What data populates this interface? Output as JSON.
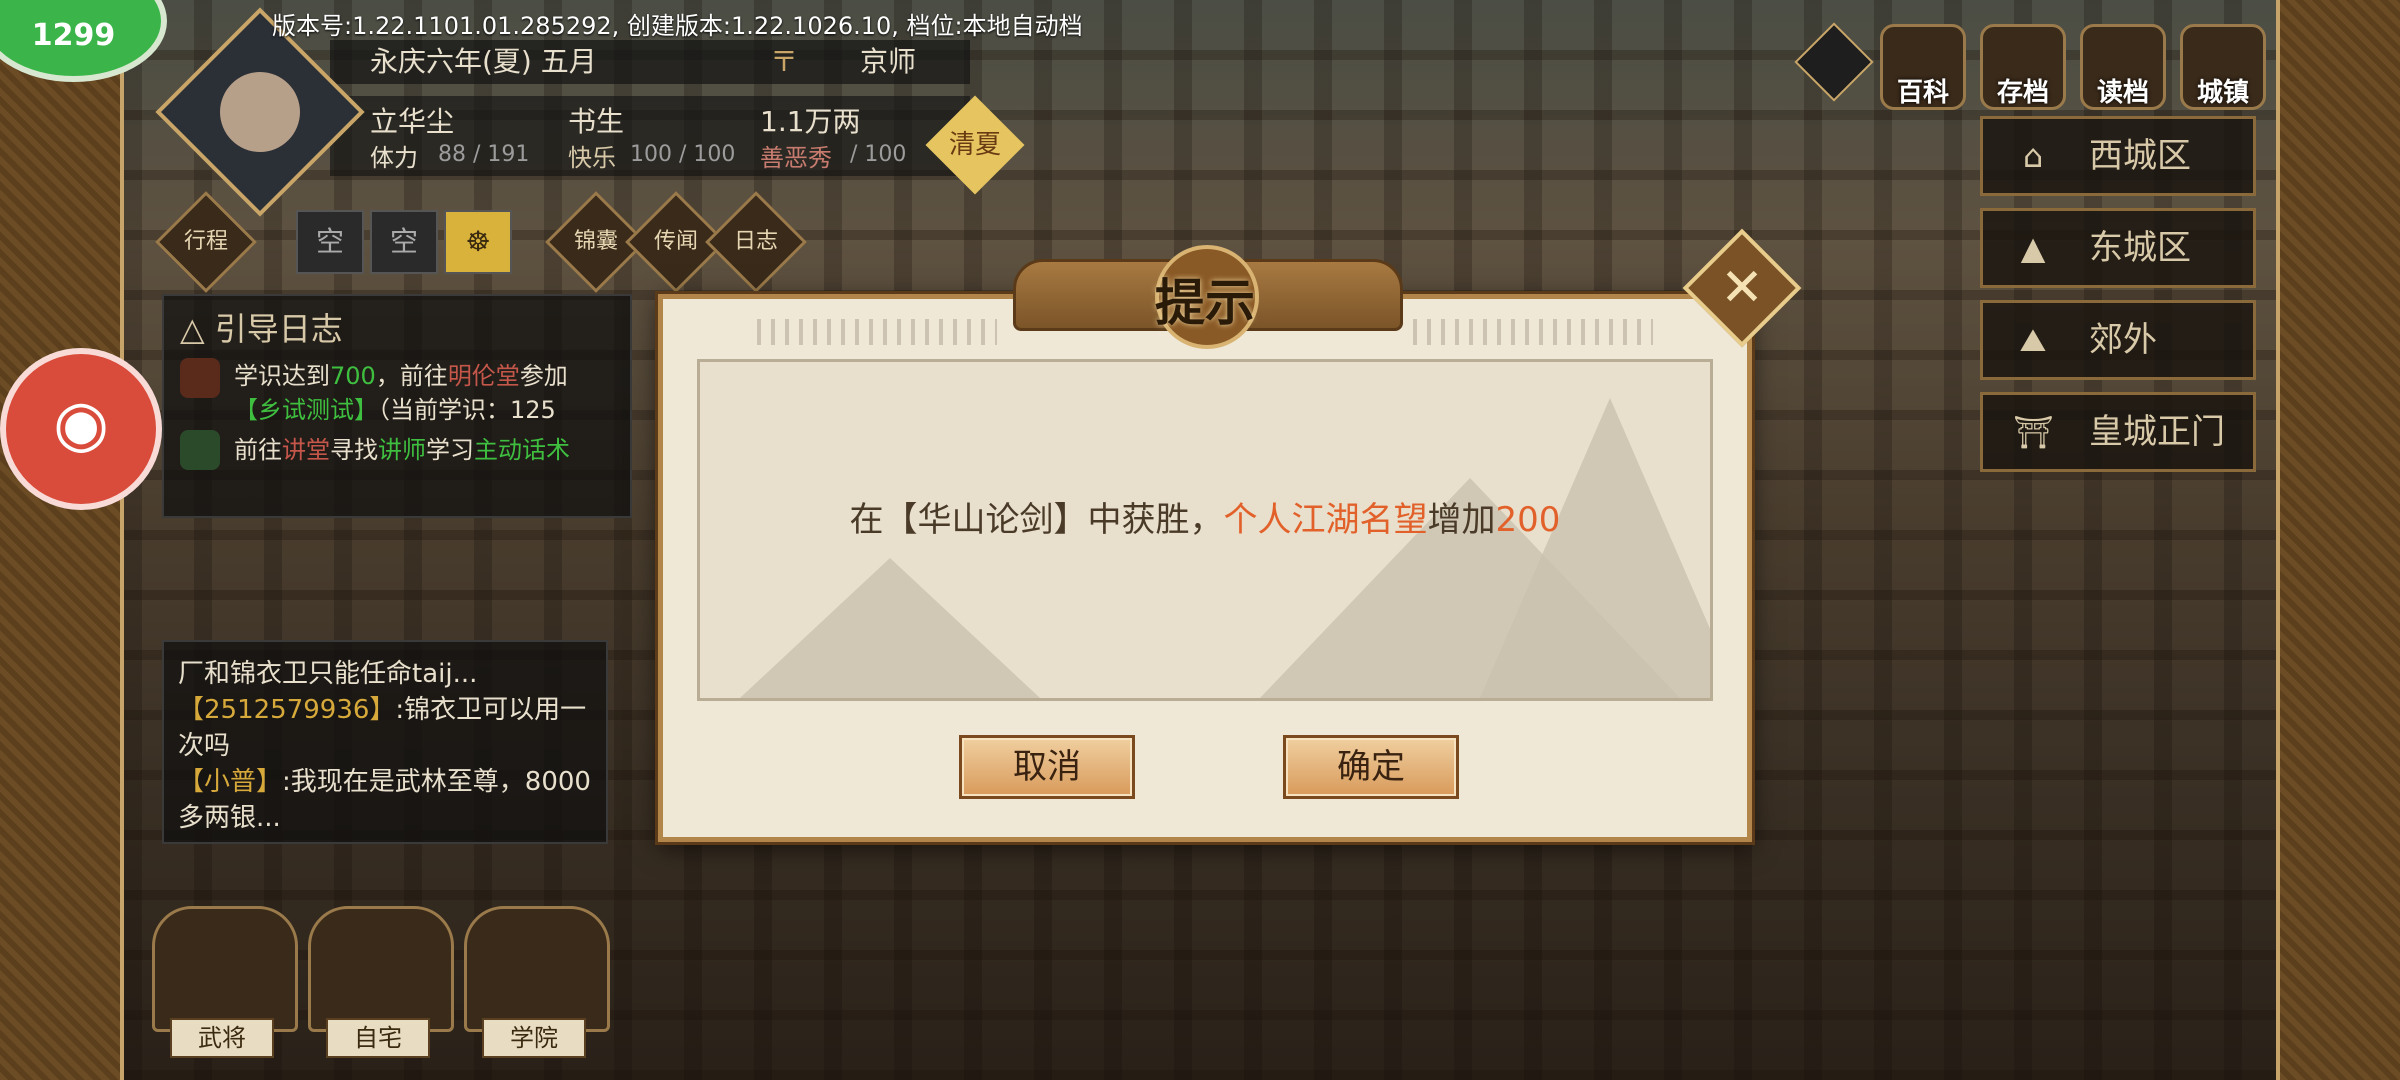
{
  "version_text": "版本号:1.22.1101.01.285292, 创建版本:1.22.1026.10, 档位:本地自动档",
  "rec_badge": "1299",
  "character": {
    "date": "永庆六年(夏) 五月",
    "location_symbol": "〒",
    "city": "京师",
    "name": "立华尘",
    "title": "书生",
    "money": "1.1万两",
    "stamina_label": "体力",
    "stamina_value": "88 / 191",
    "happy_label": "快乐",
    "happy_value": "100 / 100",
    "evil_label": "善恶秀",
    "evil_value": "/ 100",
    "status_button": "清夏"
  },
  "actions": {
    "xingcheng": "行程",
    "slot1": "空",
    "slot2": "空",
    "slot3_icon": "meditation-icon",
    "jinnang": "锦囊",
    "chuanwen": "传闻",
    "rizhi": "日志"
  },
  "guide": {
    "title": "引导日志",
    "line1_a": "学识达到",
    "line1_b": "700",
    "line1_c": "，前往",
    "line1_d": "明伦堂",
    "line1_e": "参加",
    "line2_a": "【乡试测试】",
    "line2_b": "（当前学识：125",
    "line3_a": "前往",
    "line3_b": "讲堂",
    "line3_c": "寻找",
    "line3_d": "讲师",
    "line3_e": "学习",
    "line3_f": "主动话术"
  },
  "chat": {
    "line1": "厂和锦衣卫只能任命taij...",
    "user1": "【2512579936】",
    "msg1": ":锦衣卫可以用一次吗",
    "user2": "【小普】",
    "msg2": ":我现在是武林至尊，8000多两银..."
  },
  "bottom_buildings": [
    "武将",
    "自宅",
    "学院"
  ],
  "top_menu": [
    "百科",
    "存档",
    "读档",
    "城镇"
  ],
  "districts": [
    {
      "icon": "palace-icon",
      "label": "西城区"
    },
    {
      "icon": "pagoda-icon",
      "label": "东城区"
    },
    {
      "icon": "hill-icon",
      "label": "郊外"
    },
    {
      "icon": "gate-icon",
      "label": "皇城正门"
    }
  ],
  "dialog": {
    "title": "提示",
    "msg_prefix": "在【华山论剑】中获胜，",
    "msg_highlight": "个人江湖名望",
    "msg_mid": "增加",
    "msg_value": "200",
    "cancel": "取消",
    "confirm": "确定",
    "close_symbol": "✕"
  },
  "colors": {
    "accent_orange": "#e2612b",
    "green_text": "#3fbf3f",
    "gold_border": "#b2854a"
  }
}
